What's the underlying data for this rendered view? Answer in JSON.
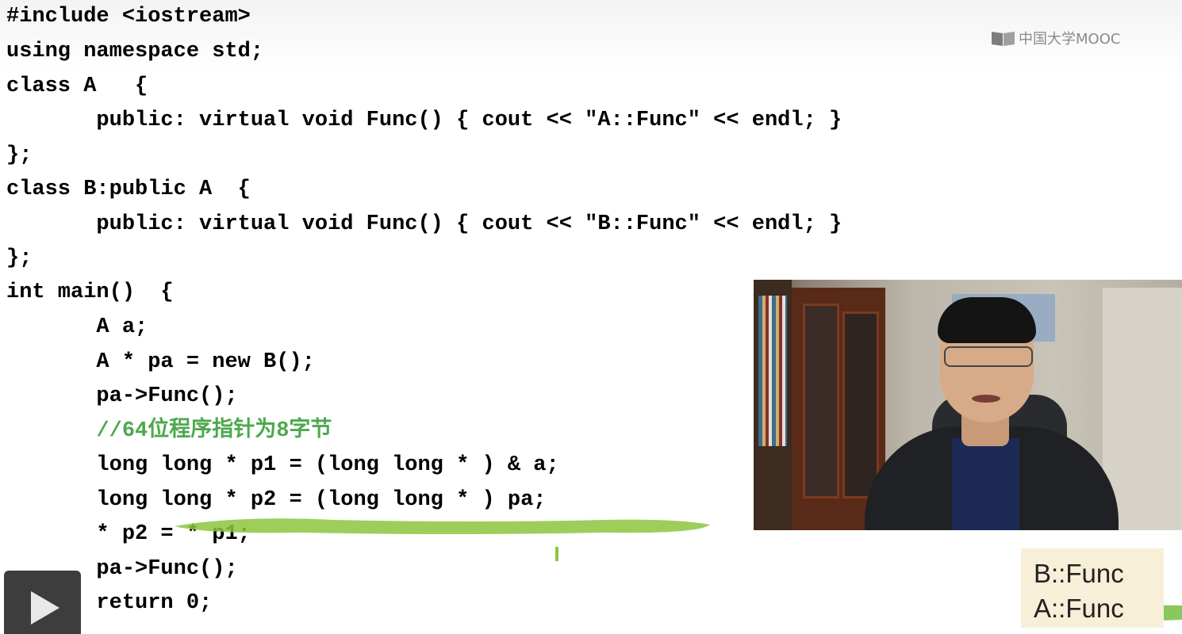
{
  "watermark": {
    "text": "中国大学MOOC",
    "icon": "mooc-book-icon"
  },
  "code": {
    "lines": [
      "#include <iostream>",
      "using namespace std;",
      "class A   {",
      "       public: virtual void Func() { cout << \"A::Func\" << endl; }",
      "};",
      "class B:public A  {",
      "       public: virtual void Func() { cout << \"B::Func\" << endl; }",
      "};",
      "int main()  {",
      "       A a;",
      "       A * pa = new B();",
      "       pa->Func();",
      "       //64位程序指针为8字节",
      "       long long * p1 = (long long * ) & a;",
      "       long long * p2 = (long long * ) pa;",
      "       * p2 = * p1;",
      "       pa->Func();",
      "       return 0;"
    ],
    "comment_color": "#4ea84e"
  },
  "output": {
    "lines": [
      "B::Func",
      "A::Func"
    ]
  },
  "annotations": {
    "highlight_color": "#8cc63f"
  },
  "player": {
    "play_icon": "play-icon"
  }
}
